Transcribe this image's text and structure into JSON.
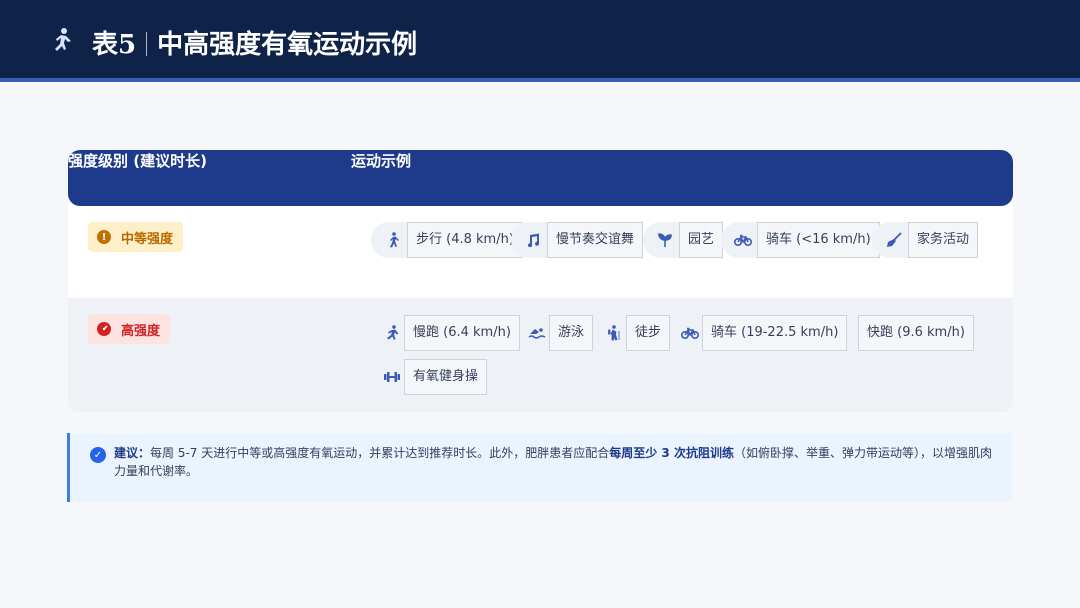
{
  "header": {
    "table_no": "表5",
    "title": "中高强度有氧运动示例",
    "icon": "running-icon"
  },
  "table": {
    "columns": [
      "强度级别 (建议时长)",
      "运动示例"
    ],
    "rows": [
      {
        "level": "中等强度",
        "level_icon": "info-icon",
        "level_color": "#b86a00",
        "examples": [
          {
            "label": "步行 (4.8 km/h)",
            "icon": "walking-icon"
          },
          {
            "label": "慢节奏交谊舞",
            "icon": "music-note-icon"
          },
          {
            "label": "园艺",
            "icon": "sprout-icon"
          },
          {
            "label": "骑车 (<16 km/h)",
            "icon": "bicycle-icon"
          },
          {
            "label": "家务活动",
            "icon": "broom-icon"
          }
        ]
      },
      {
        "level": "高强度",
        "level_icon": "gauge-icon",
        "level_color": "#d02424",
        "examples": [
          {
            "label": "慢跑 (6.4 km/h)",
            "icon": "running-icon"
          },
          {
            "label": "游泳",
            "icon": "swimming-icon"
          },
          {
            "label": "徒步",
            "icon": "hiking-icon"
          },
          {
            "label": "骑车 (19-22.5 km/h)",
            "icon": "bicycle-icon"
          },
          {
            "label": "快跑 (9.6 km/h)",
            "icon": ""
          },
          {
            "label": "有氧健身操",
            "icon": "dumbbell-icon"
          }
        ]
      }
    ]
  },
  "note": {
    "label": "建议：",
    "text_1": "每周 5-7 天进行中等或高强度有氧运动，并累计达到推荐时长。此外，肥胖患者应配合",
    "emphasis": "每周至少 3 次抗阻训练",
    "text_2": "（如俯卧撑、举重、弹力带运动等），以增强肌肉力量和代谢率。"
  },
  "colors": {
    "header_bg": "#0f2348",
    "table_header_bg": "#1e3a8a",
    "accent": "#3b5bb5",
    "note_bg": "#eaf3fe"
  }
}
